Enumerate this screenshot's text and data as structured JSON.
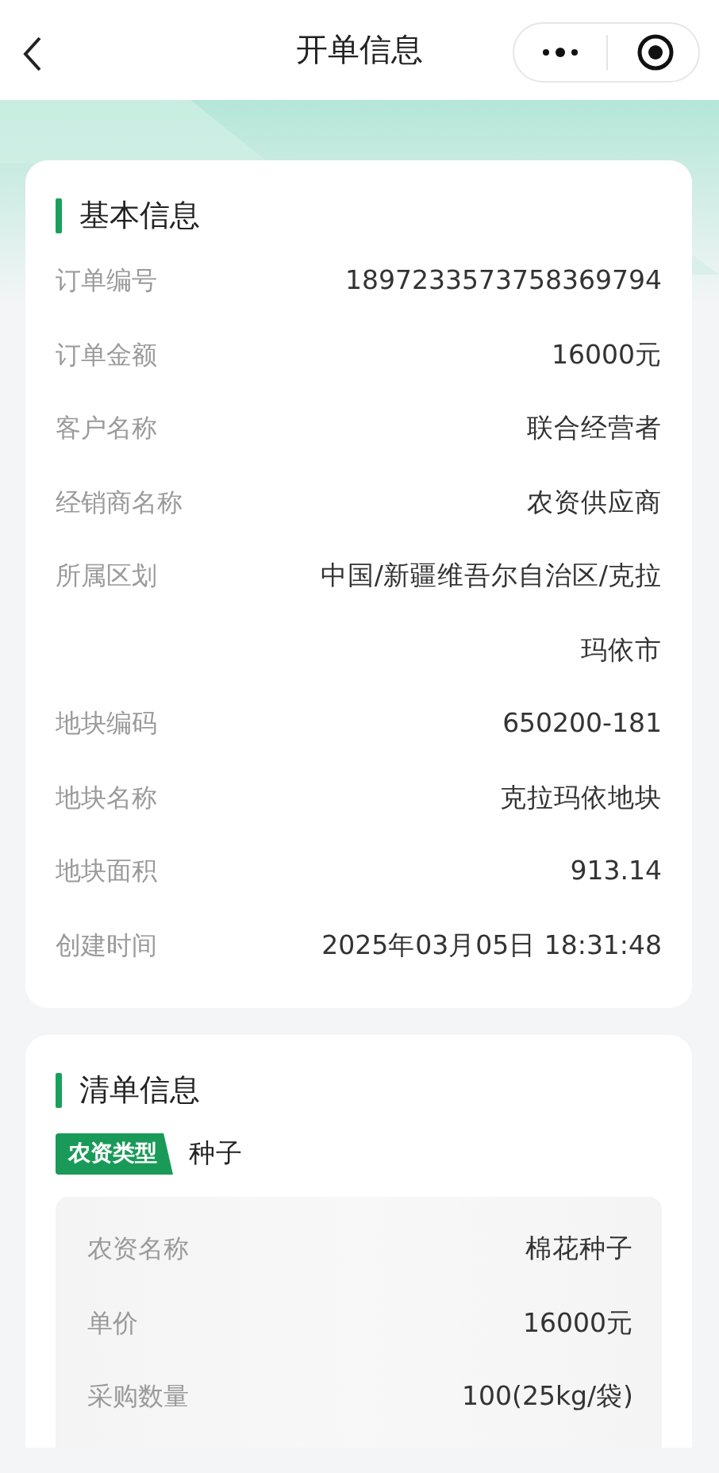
{
  "nav": {
    "title": "开单信息"
  },
  "basic": {
    "title": "基本信息",
    "rows": [
      {
        "label": "订单编号",
        "value": "1897233573758369794"
      },
      {
        "label": "订单金额",
        "value": "16000元"
      },
      {
        "label": "客户名称",
        "value": "联合经营者"
      },
      {
        "label": "经销商名称",
        "value": "农资供应商"
      },
      {
        "label": "所属区划",
        "value": "中国/新疆维吾尔自治区/克拉玛依市"
      },
      {
        "label": "地块编码",
        "value": "650200-181"
      },
      {
        "label": "地块名称",
        "value": "克拉玛依地块"
      },
      {
        "label": "地块面积",
        "value": "913.14"
      },
      {
        "label": "创建时间",
        "value": "2025年03月05日 18:31:48"
      }
    ]
  },
  "list": {
    "title": "清单信息",
    "tag": "农资类型",
    "type": "种子",
    "rows": [
      {
        "label": "农资名称",
        "value": "棉花种子"
      },
      {
        "label": "单价",
        "value": "16000元"
      },
      {
        "label": "采购数量",
        "value": "100(25kg/袋)"
      }
    ]
  }
}
